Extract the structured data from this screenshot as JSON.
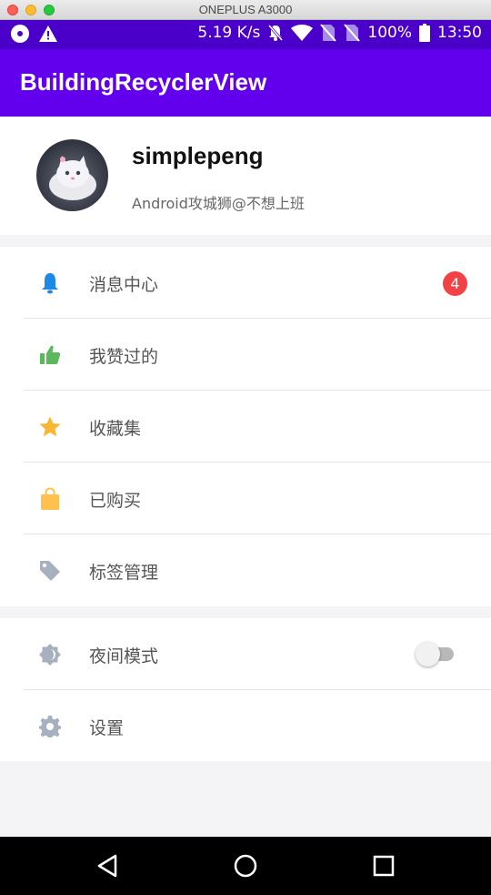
{
  "window": {
    "title": "ONEPLUS A3000"
  },
  "status_bar": {
    "speed": "5.19 K/s",
    "battery": "100%",
    "time": "13:50"
  },
  "app_bar": {
    "title": "BuildingRecyclerView"
  },
  "profile": {
    "username": "simplepeng",
    "bio": "Android攻城狮@不想上班"
  },
  "menu": [
    {
      "label": "消息中心",
      "icon": "bell-icon",
      "color": "#1e88e5",
      "badge": "4"
    },
    {
      "label": "我赞过的",
      "icon": "thumbs-up-icon",
      "color": "#5cb85c"
    },
    {
      "label": "收藏集",
      "icon": "star-icon",
      "color": "#f7b733"
    },
    {
      "label": "已购买",
      "icon": "shopping-bag-icon",
      "color": "#ffc04d"
    },
    {
      "label": "标签管理",
      "icon": "tag-icon",
      "color": "#a7b0bf"
    }
  ],
  "settings_menu": [
    {
      "label": "夜间模式",
      "icon": "brightness-icon",
      "color": "#a7b0bf",
      "toggle_on": false
    },
    {
      "label": "设置",
      "icon": "gear-icon",
      "color": "#a7b0bf"
    }
  ],
  "colors": {
    "status_bar": "#4a00c8",
    "app_bar": "#6200ee",
    "badge": "#f44144"
  }
}
